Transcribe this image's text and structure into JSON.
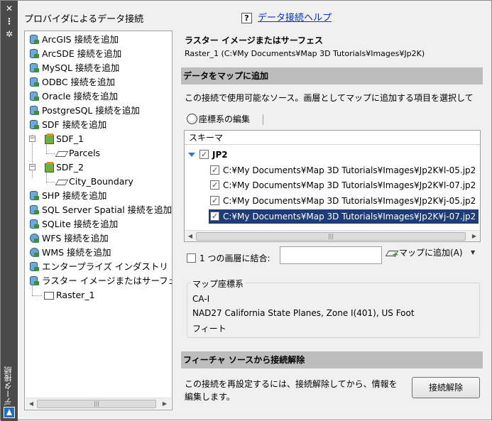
{
  "window": {
    "vertical_title": "データ接続",
    "controls": [
      "✕",
      "⋮",
      "✲"
    ]
  },
  "left": {
    "title": "プロバイダによるデータ接続",
    "tree": [
      {
        "label": "ArcGIS 接続を追加",
        "icon": "database-icon"
      },
      {
        "label": "ArcSDE 接続を追加",
        "icon": "database-icon"
      },
      {
        "label": "MySQL 接続を追加",
        "icon": "database-icon"
      },
      {
        "label": "ODBC 接続を追加",
        "icon": "database-icon"
      },
      {
        "label": "Oracle 接続を追加",
        "icon": "database-icon"
      },
      {
        "label": "PostgreSQL 接続を追加",
        "icon": "database-icon"
      },
      {
        "label": "SDF 接続を追加",
        "icon": "database-icon"
      },
      {
        "label": "SDF_1",
        "icon": "feature-source-icon"
      },
      {
        "label": "Parcels",
        "icon": "feature-class-icon"
      },
      {
        "label": "SDF_2",
        "icon": "feature-source-icon"
      },
      {
        "label": "City_Boundary",
        "icon": "feature-class-icon"
      },
      {
        "label": "SHP 接続を追加",
        "icon": "database-icon"
      },
      {
        "label": "SQL Server Spatial 接続を追加",
        "icon": "database-icon"
      },
      {
        "label": "SQLite 接続を追加",
        "icon": "database-icon"
      },
      {
        "label": "WFS 接続を追加",
        "icon": "globe-icon"
      },
      {
        "label": "WMS 接続を追加",
        "icon": "globe-icon"
      },
      {
        "label": "エンタープライズ インダストリ モ",
        "icon": "database-icon"
      },
      {
        "label": "ラスター イメージまたはサーフェ",
        "icon": "database-icon"
      },
      {
        "label": "Raster_1",
        "icon": "raster-icon"
      }
    ]
  },
  "right": {
    "help_label": "データ接続ヘルプ",
    "raster_title": "ラスター イメージまたはサーフェス",
    "raster_path": "Raster_1 (C:¥My Documents¥Map 3D Tutorials¥Images¥Jp2K)",
    "add_band": "データをマップに追加",
    "add_desc": "この接続で使用可能なソース。画層としてマップに追加する項目を選択して",
    "cs_edit_label": "座標系の編集",
    "schema_header": "スキーマ",
    "schema_root": "JP2",
    "schema_items": [
      {
        "path": "C:¥My Documents¥Map 3D Tutorials¥Images¥Jp2K¥l-05.jp2",
        "checked": true,
        "selected": false
      },
      {
        "path": "C:¥My Documents¥Map 3D Tutorials¥Images¥Jp2K¥l-07.jp2",
        "checked": true,
        "selected": false
      },
      {
        "path": "C:¥My Documents¥Map 3D Tutorials¥Images¥Jp2K¥j-05.jp2",
        "checked": true,
        "selected": false
      },
      {
        "path": "C:¥My Documents¥Map 3D Tutorials¥Images¥Jp2K¥j-07.jp2",
        "checked": true,
        "selected": true
      }
    ],
    "combine_label": "1 つの画層に結合:",
    "combine_value": "",
    "add_to_map_label": "マップに追加(A)",
    "map_cs_legend": "マップ座標系",
    "map_cs_lines": [
      "CA-I",
      "NAD27 California State Planes, Zone I(401), US Foot",
      "フィート"
    ],
    "disconnect_band": "フィーチャ ソースから接続解除",
    "disconnect_desc": "この接続を再設定するには、接続解除してから、情報を編集します。",
    "disconnect_button": "接続解除"
  }
}
